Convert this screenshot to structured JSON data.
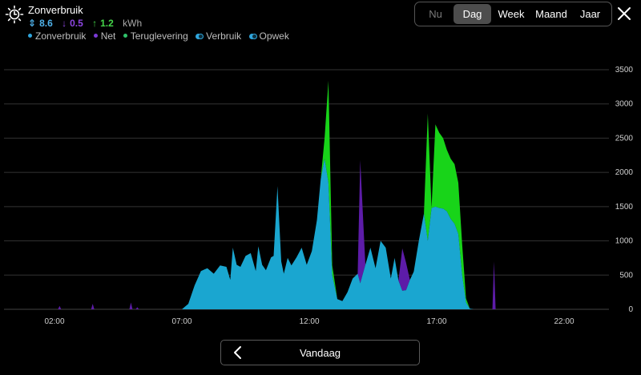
{
  "header": {
    "title": "Zonverbruik",
    "stats": [
      {
        "arrow": "⇕",
        "value": "8.6",
        "color": "#4fb3ec"
      },
      {
        "arrow": "↓",
        "value": "0.5",
        "color": "#8e46e3"
      },
      {
        "arrow": "↑",
        "value": "1.2",
        "color": "#45d64a"
      }
    ],
    "unit": "kWh",
    "legend": [
      "Zonverbruik",
      "Net",
      "Teruglevering",
      "Verbruik",
      "Opwek"
    ]
  },
  "period_tabs": [
    "Nu",
    "Dag",
    "Week",
    "Maand",
    "Jaar"
  ],
  "active_period": "Dag",
  "nav": {
    "label": "Vandaag"
  },
  "colors": {
    "zonverbruik": "#1aa6d0",
    "net": "#5d1ca8",
    "teruglevering": "#18d419",
    "grid": "#333333"
  },
  "chart_data": {
    "type": "area",
    "title": "",
    "y_ticks": [
      0,
      500,
      1000,
      1500,
      2000,
      2500,
      3000,
      3500
    ],
    "ylim": [
      0,
      3500
    ],
    "x_ticks": [
      "02:00",
      "07:00",
      "12:00",
      "17:00",
      "22:00"
    ],
    "xlim": [
      0.5,
      24
    ],
    "grid": true,
    "x_hours": [
      6.25,
      6.5,
      6.75,
      7.0,
      7.25,
      7.5,
      7.75,
      8.0,
      8.25,
      8.5,
      8.75,
      8.9,
      9.0,
      9.15,
      9.3,
      9.5,
      9.7,
      9.9,
      10.0,
      10.15,
      10.3,
      10.5,
      10.6,
      10.75,
      10.9,
      11.0,
      11.15,
      11.3,
      11.5,
      11.7,
      11.9,
      12.1,
      12.3,
      12.45,
      12.6,
      12.75,
      12.9,
      13.1,
      13.3,
      13.5,
      13.7,
      13.9,
      14.0,
      14.2,
      14.4,
      14.6,
      14.8,
      15.0,
      15.2,
      15.35,
      15.5,
      15.65,
      15.8,
      15.95,
      16.1,
      16.3,
      16.5,
      16.65,
      16.8,
      16.95,
      17.1,
      17.25,
      17.4,
      17.55,
      17.7,
      17.85,
      18.0,
      18.15,
      18.3,
      18.45,
      18.6,
      18.75,
      19.0
    ],
    "series": [
      {
        "name": "Zonverbruik",
        "values": [
          0,
          0,
          0,
          0,
          80,
          350,
          560,
          600,
          520,
          640,
          620,
          430,
          900,
          650,
          620,
          780,
          820,
          560,
          920,
          650,
          570,
          760,
          780,
          1800,
          700,
          520,
          750,
          640,
          760,
          900,
          650,
          850,
          1300,
          1900,
          2200,
          1850,
          500,
          150,
          120,
          250,
          450,
          520,
          380,
          650,
          900,
          600,
          1000,
          900,
          450,
          750,
          420,
          270,
          280,
          430,
          550,
          1000,
          1400,
          1000,
          1480,
          1500,
          1480,
          1470,
          1430,
          1320,
          1250,
          1100,
          500,
          100,
          10,
          0,
          0,
          0,
          0
        ]
      },
      {
        "name": "Net",
        "values": [
          0,
          0,
          0,
          0,
          0,
          0,
          0,
          0,
          0,
          0,
          0,
          0,
          0,
          0,
          0,
          0,
          0,
          0,
          0,
          0,
          0,
          0,
          0,
          0,
          0,
          0,
          0,
          0,
          0,
          0,
          0,
          0,
          0,
          0,
          0,
          0,
          0,
          0,
          0,
          0,
          0,
          0,
          1800,
          0,
          0,
          0,
          0,
          0,
          0,
          0,
          0,
          620,
          400,
          0,
          0,
          0,
          0,
          0,
          0,
          0,
          0,
          0,
          0,
          0,
          0,
          0,
          0,
          0,
          0,
          0,
          0,
          0,
          0
        ]
      },
      {
        "name": "Teruglevering",
        "values": [
          0,
          0,
          0,
          0,
          0,
          0,
          0,
          0,
          0,
          0,
          0,
          0,
          0,
          0,
          0,
          0,
          0,
          0,
          0,
          0,
          0,
          0,
          0,
          0,
          0,
          0,
          0,
          0,
          0,
          0,
          0,
          0,
          0,
          0,
          300,
          1490,
          150,
          0,
          0,
          0,
          0,
          0,
          0,
          0,
          0,
          0,
          0,
          0,
          0,
          0,
          0,
          0,
          0,
          0,
          0,
          0,
          0,
          1860,
          0,
          1200,
          1100,
          1030,
          900,
          880,
          870,
          750,
          450,
          60,
          0,
          0,
          0,
          0,
          0
        ]
      }
    ],
    "small_net_spikes": [
      {
        "x": 2.2,
        "value": 50
      },
      {
        "x": 3.5,
        "value": 80
      },
      {
        "x": 5.0,
        "value": 100
      },
      {
        "x": 5.25,
        "value": 30
      },
      {
        "x": 19.25,
        "value": 700
      }
    ]
  }
}
